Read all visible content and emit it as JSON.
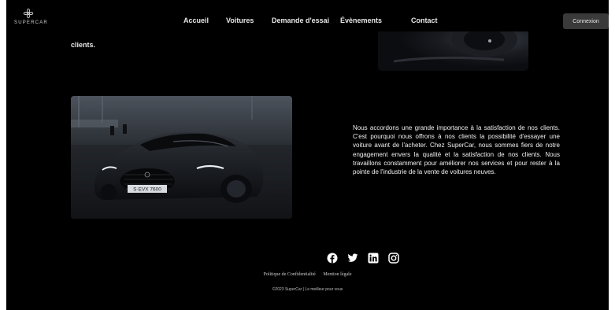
{
  "brand": {
    "name": "SUPERCAR"
  },
  "nav": {
    "items": [
      {
        "label": "Accueil"
      },
      {
        "label": "Voitures"
      },
      {
        "label": "Demande d'essai"
      },
      {
        "label": "Évènements"
      },
      {
        "label": "Contact"
      }
    ],
    "login_label": "Connexion"
  },
  "section_fragment": {
    "text": "clients."
  },
  "main": {
    "car_plate": "S·EVX 7600",
    "description": "Nous accordons une grande importance à la satisfaction de nos clients. C'est pourquoi nous offrons à nos clients la possibilité d'essayer une voiture avant de l'acheter. Chez SuperCar, nous sommes fiers de notre engagement envers la qualité et la satisfaction de nos clients. Nous travaillons constamment pour améliorer nos services et pour rester à la pointe de l'industrie de la vente de voitures neuves."
  },
  "footer": {
    "social_icons": [
      "facebook-icon",
      "twitter-icon",
      "linkedin-icon",
      "instagram-icon"
    ],
    "links": [
      {
        "label": "Politique de Confidentialité"
      },
      {
        "label": "Mention légale"
      }
    ],
    "copyright": "©2023 SuperCar | Le meilleur pour vous"
  },
  "colors": {
    "background": "#000000",
    "nav_text": "#e6e6e6",
    "button_bg": "#3a3a3a"
  }
}
